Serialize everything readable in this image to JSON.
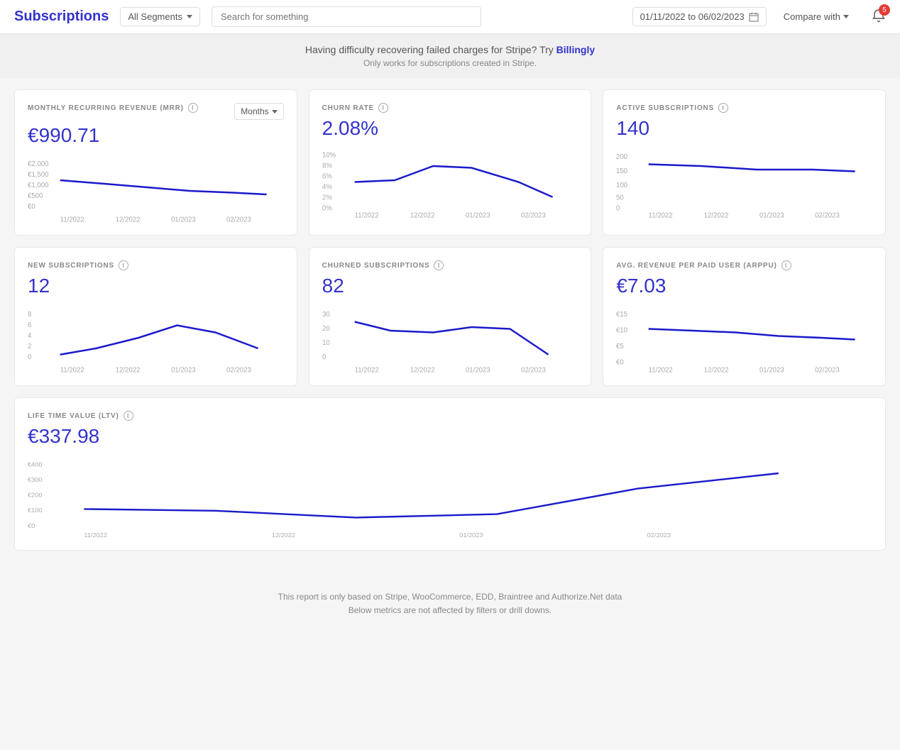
{
  "header": {
    "title": "Subscriptions",
    "segments_label": "All Segments",
    "search_placeholder": "Search for something",
    "date_range": "01/11/2022  to  06/02/2023",
    "compare_label": "Compare with",
    "notification_count": "5"
  },
  "banner": {
    "text_before": "Having difficulty recovering failed charges for Stripe? Try ",
    "link_text": "Billingly",
    "subtext": "Only works for subscriptions created in Stripe."
  },
  "cards": {
    "mrr": {
      "label": "MONTHLY RECURRING REVENUE (MRR)",
      "value": "€990.71",
      "months_label": "Months"
    },
    "churn": {
      "label": "CHURN RATE",
      "value": "2.08%"
    },
    "active": {
      "label": "ACTIVE SUBSCRIPTIONS",
      "value": "140"
    },
    "new_subs": {
      "label": "NEW SUBSCRIPTIONS",
      "value": "12"
    },
    "churned": {
      "label": "CHURNED SUBSCRIPTIONS",
      "value": "82"
    },
    "arppu": {
      "label": "AVG. REVENUE PER PAID USER (ARPPU)",
      "value": "€7.03"
    },
    "ltv": {
      "label": "LIFE TIME VALUE (LTV)",
      "value": "€337.98"
    }
  },
  "footer": {
    "line1": "This report is only based on Stripe, WooCommerce, EDD, Braintree and Authorize.Net data",
    "line2": "Below metrics are not affected by filters or drill downs."
  }
}
